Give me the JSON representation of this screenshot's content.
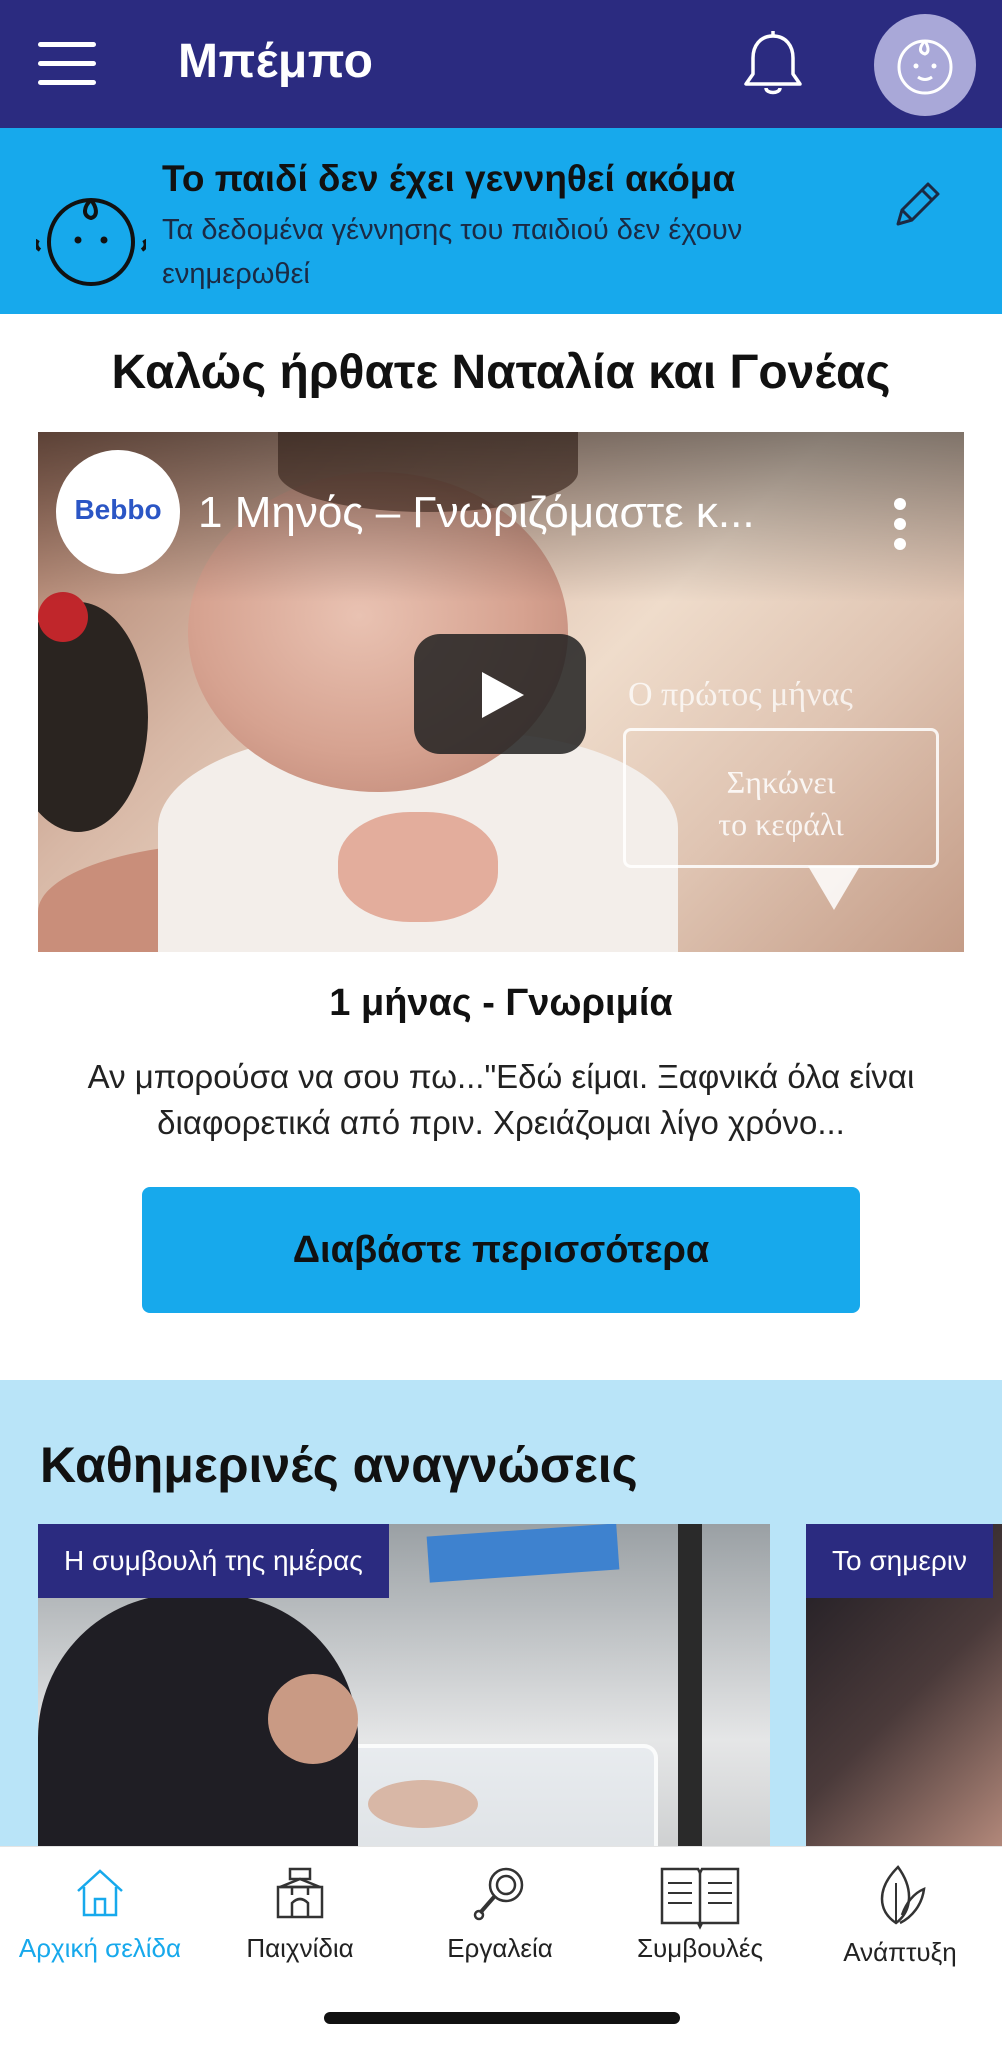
{
  "header": {
    "title": "Μπέμπο",
    "icons": {
      "menu": "hamburger-menu-icon",
      "notifications": "bell-icon",
      "profile": "baby-face-icon"
    },
    "colors": {
      "background": "#2b2b80",
      "avatar": "#a9a8d8"
    }
  },
  "banner": {
    "title": "Το παιδί δεν έχει γεννηθεί ακόμα",
    "subtitle": "Τα δεδομένα γέννησης του παιδιού δεν έχουν ενημερωθεί",
    "color": "#17a9ec"
  },
  "welcome": {
    "text": "Καλώς ήρθατε Ναταλία και Γονέας"
  },
  "video": {
    "logo_text": "Bebbo",
    "title": "1 Μηνός – Γνωριζόμαστε κ...",
    "overlay_text": "Ο πρώτος μήνας",
    "bubble_line1": "Σηκώνει",
    "bubble_line2": "το κεφάλι"
  },
  "article": {
    "title": "1 μήνας - Γνωριμία",
    "description": "Αν μπορούσα να σου πω...\"Εδώ είμαι. Ξαφνικά όλα είναι διαφορετικά από πριν. Χρειάζομαι λίγο χρόνο...",
    "button_label": "Διαβάστε περισσότερα"
  },
  "daily_readings": {
    "title": "Καθημερινές αναγνώσεις",
    "cards": [
      {
        "label": "Η συμβουλή της ημέρας"
      },
      {
        "label": "Το σημεριν"
      }
    ],
    "background": "#b9e4f8"
  },
  "bottom_nav": {
    "items": [
      {
        "label": "Αρχική σελίδα",
        "icon": "home-icon",
        "active": true
      },
      {
        "label": "Παιχνίδια",
        "icon": "toy-blocks-icon",
        "active": false
      },
      {
        "label": "Εργαλεία",
        "icon": "rattle-icon",
        "active": false
      },
      {
        "label": "Συμβουλές",
        "icon": "open-book-icon",
        "active": false
      },
      {
        "label": "Ανάπτυξη",
        "icon": "leaf-icon",
        "active": false
      }
    ],
    "active_color": "#17a9ec"
  }
}
